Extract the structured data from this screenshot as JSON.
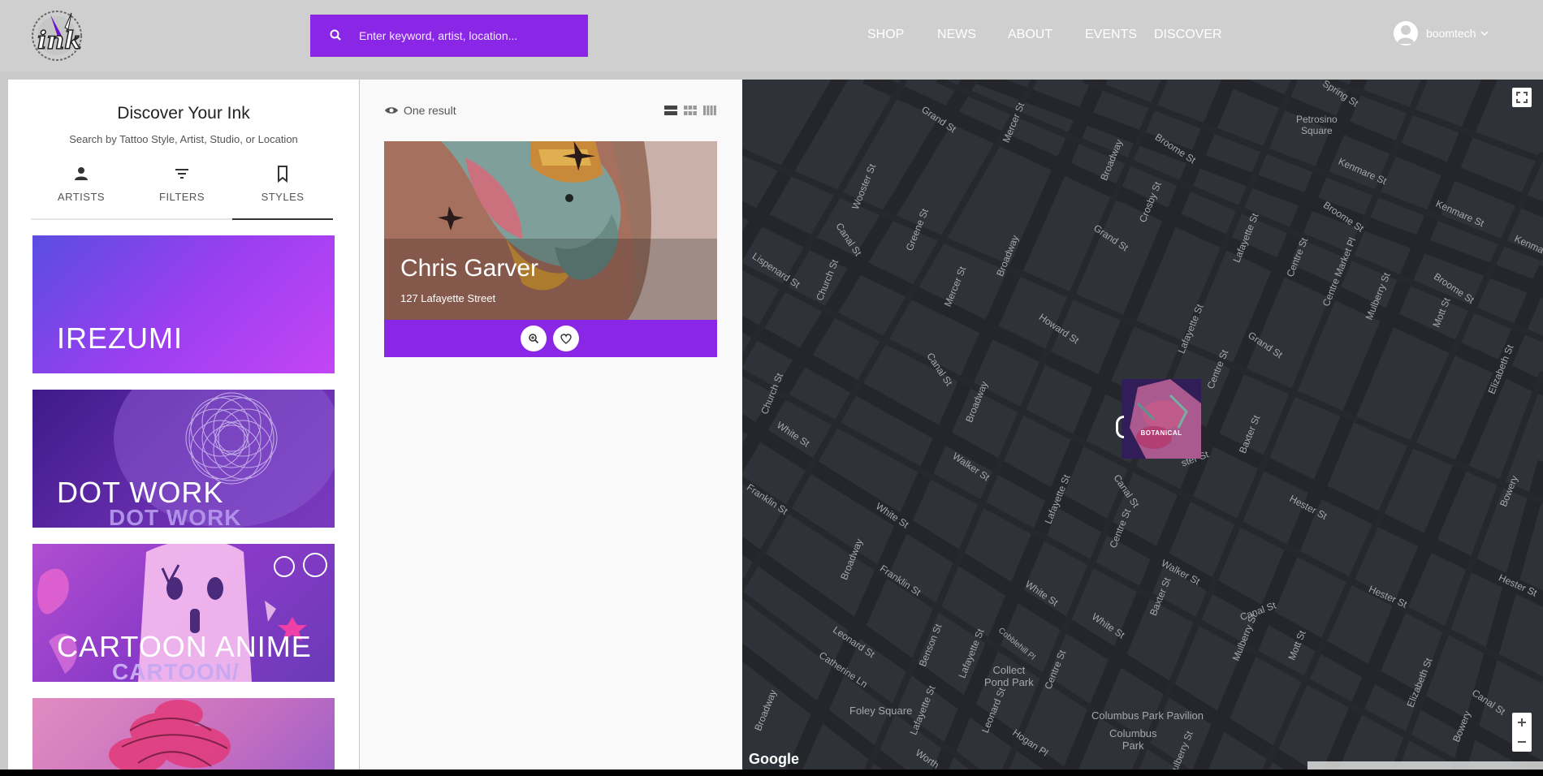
{
  "header": {
    "logo_text": "ink",
    "search": {
      "placeholder": "Enter keyword, artist, location..."
    },
    "nav": [
      {
        "label": "SHOP"
      },
      {
        "label": "NEWS"
      },
      {
        "label": "ABOUT"
      },
      {
        "label": "EVENTS"
      },
      {
        "label": "DISCOVER"
      }
    ],
    "user": {
      "name": "boomtech"
    }
  },
  "left": {
    "title": "Discover Your Ink",
    "subtitle": "Search by Tattoo Style, Artist, Studio, or Location",
    "tabs": [
      {
        "label": "ARTISTS",
        "icon": "person-icon",
        "active": false
      },
      {
        "label": "FILTERS",
        "icon": "filter-icon",
        "active": false
      },
      {
        "label": "STYLES",
        "icon": "bookmark-icon",
        "active": true
      }
    ],
    "styles": [
      {
        "label": "IREZUMI"
      },
      {
        "label": "DOT WORK",
        "watermark": "DOT WORK"
      },
      {
        "label": "CARTOON ANIME",
        "watermark": "CARTOON/"
      },
      {
        "label": ""
      }
    ]
  },
  "middle": {
    "results_text": "One result",
    "cards": [
      {
        "name": "Chris Garver",
        "address": "127 Lafayette Street"
      }
    ]
  },
  "map": {
    "brand": "Google",
    "marker": {
      "label": "BOTANICAL"
    },
    "places": {
      "petrosino": "Petrosino\nSquare",
      "collect": "Collect\nPond Park",
      "foley": "Foley Square",
      "columbus_pavilion": "Columbus Park Pavilion",
      "columbus_park": "Columbus\nPark"
    },
    "streets": {
      "grand_st_1": "Grand St",
      "mercer_st_1": "Mercer St",
      "broome_st_1": "Broome St",
      "spring_st": "Spring St",
      "wooster_st": "Wooster St",
      "broadway_1": "Broadway",
      "crosby_st": "Crosby St",
      "kenmare_1": "Kenmare St",
      "kenmare_2": "Kenmare St",
      "kenma": "Kenma",
      "canal_st_1": "Canal St",
      "greene_st": "Greene St",
      "grand_st_2": "Grand St",
      "lafayette_1": "Lafayette St",
      "broome_st_2": "Broome St",
      "centre_st_1": "Centre St",
      "centre_market": "Centre Market Pl",
      "mulberry_1": "Mulberry St",
      "mott_1": "Mott St",
      "broome_st_3": "Broome St",
      "lispenard": "Lispenard St",
      "church_1": "Church St",
      "mercer_st_2": "Mercer St",
      "broadway_2": "Broadway",
      "howard": "Howard St",
      "lafayette_2": "Lafayette St",
      "grand_st_3": "Grand St",
      "centre_st_2": "Centre St",
      "elizabeth_1": "Elizabeth St",
      "church_2": "Church St",
      "canal_st_2": "Canal St",
      "broadway_3": "Broadway",
      "white_1": "White St",
      "walker_1": "Walker St",
      "lafayette_3": "Lafayette St",
      "canal_st_3": "Canal St",
      "baxter_1": "Baxter St",
      "ster": "ster St",
      "hester_1": "Hester St",
      "franklin_1": "Franklin St",
      "white_2": "White St",
      "centre_st_3": "Centre St",
      "broadway_4": "Broadway",
      "franklin_2": "Franklin St",
      "white_3": "White St",
      "walker_2": "Walker St",
      "baxter_2": "Baxter St",
      "canal_st_4": "Canal St",
      "mulberry_2": "Mulberry St",
      "mott_2": "Mott St",
      "leonard_1": "Leonard St",
      "benson": "Benson St",
      "lafayette_4": "Lafayette St",
      "cobblehill": "Cobblehill Pl",
      "centre_st_4": "Centre St",
      "white_4": "White St",
      "catherine": "Catherine Ln",
      "broadway_5": "Broadway",
      "lafayette_5": "Lafayette St",
      "leonard_2": "Leonard St",
      "hogan": "Hogan Pl",
      "worth": "Worth",
      "elizabeth_2": "Elizabeth St",
      "bowery_1": "Bowery",
      "bowery_2": "Bowery",
      "hester_2": "Hester St",
      "canal_st_5": "Canal St",
      "hester_3": "Hester St",
      "ulberry": "ulberry St"
    }
  },
  "colors": {
    "accent": "#8a26e6",
    "header_bg": "#cfcfcf",
    "map_bg": "#2f3238",
    "irezumi_start": "#5a4de0",
    "irezumi_end": "#c445f5"
  }
}
